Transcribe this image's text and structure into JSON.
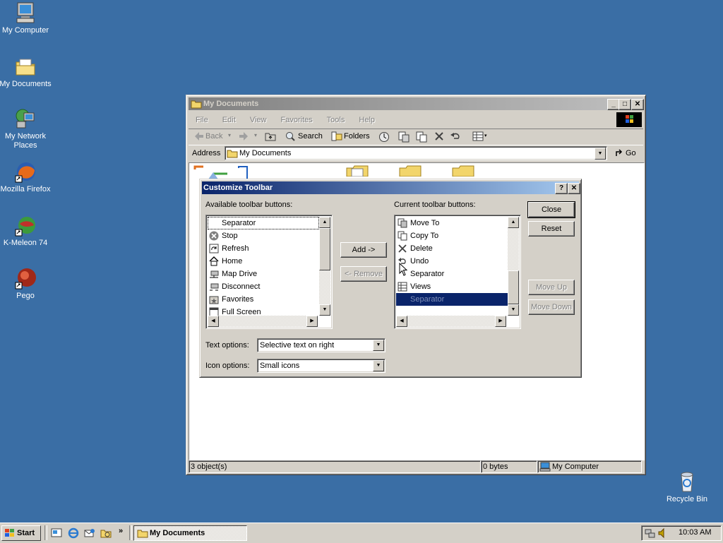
{
  "desktop": {
    "icons": [
      {
        "label": "My Computer",
        "icon": "computer-icon"
      },
      {
        "label": "My Documents",
        "icon": "folder-documents-icon"
      },
      {
        "label": "My Network Places",
        "icon": "network-icon"
      },
      {
        "label": "Mozilla Firefox",
        "icon": "firefox-icon"
      },
      {
        "label": "K-Meleon 74",
        "icon": "kmeleon-icon"
      },
      {
        "label": "Pego",
        "icon": "pego-icon"
      },
      {
        "label": "Recycle Bin",
        "icon": "recycle-bin-icon"
      }
    ]
  },
  "explorer": {
    "title": "My Documents",
    "menu": [
      "File",
      "Edit",
      "View",
      "Favorites",
      "Tools",
      "Help"
    ],
    "toolbar": {
      "back": "Back",
      "search": "Search",
      "folders": "Folders"
    },
    "address": {
      "label": "Address",
      "value": "My Documents",
      "go": "Go"
    },
    "status": {
      "objects": "3 object(s)",
      "size": "0 bytes",
      "zone": "My Computer"
    }
  },
  "dialog": {
    "title": "Customize Toolbar",
    "help": "?",
    "available_label": "Available toolbar buttons:",
    "current_label": "Current toolbar buttons:",
    "available_items": [
      {
        "label": "Separator",
        "icon": "separator-icon"
      },
      {
        "label": "Stop",
        "icon": "stop-icon"
      },
      {
        "label": "Refresh",
        "icon": "refresh-icon"
      },
      {
        "label": "Home",
        "icon": "home-icon"
      },
      {
        "label": "Map Drive",
        "icon": "map-drive-icon"
      },
      {
        "label": "Disconnect",
        "icon": "disconnect-icon"
      },
      {
        "label": "Favorites",
        "icon": "favorites-icon"
      },
      {
        "label": "Full Screen",
        "icon": "full-screen-icon"
      }
    ],
    "current_items": [
      {
        "label": "Move To",
        "icon": "move-to-icon"
      },
      {
        "label": "Copy To",
        "icon": "copy-to-icon"
      },
      {
        "label": "Delete",
        "icon": "delete-icon"
      },
      {
        "label": "Undo",
        "icon": "undo-icon"
      },
      {
        "label": "Separator",
        "icon": "separator-icon"
      },
      {
        "label": "Views",
        "icon": "views-icon"
      },
      {
        "label": "Separator",
        "icon": "separator-icon",
        "selected": true
      }
    ],
    "buttons": {
      "add": "Add ->",
      "remove": "<- Remove",
      "close": "Close",
      "reset": "Reset",
      "move_up": "Move Up",
      "move_down": "Move Down"
    },
    "text_options": {
      "label": "Text options:",
      "value": "Selective text on right"
    },
    "icon_options": {
      "label": "Icon options:",
      "value": "Small icons"
    }
  },
  "taskbar": {
    "start": "Start",
    "task": "My Documents",
    "clock": "10:03 AM",
    "chevron": "»"
  },
  "colors": {
    "desktop": "#3a6ea5",
    "selection": "#0a246a",
    "face": "#d4d0c8"
  }
}
